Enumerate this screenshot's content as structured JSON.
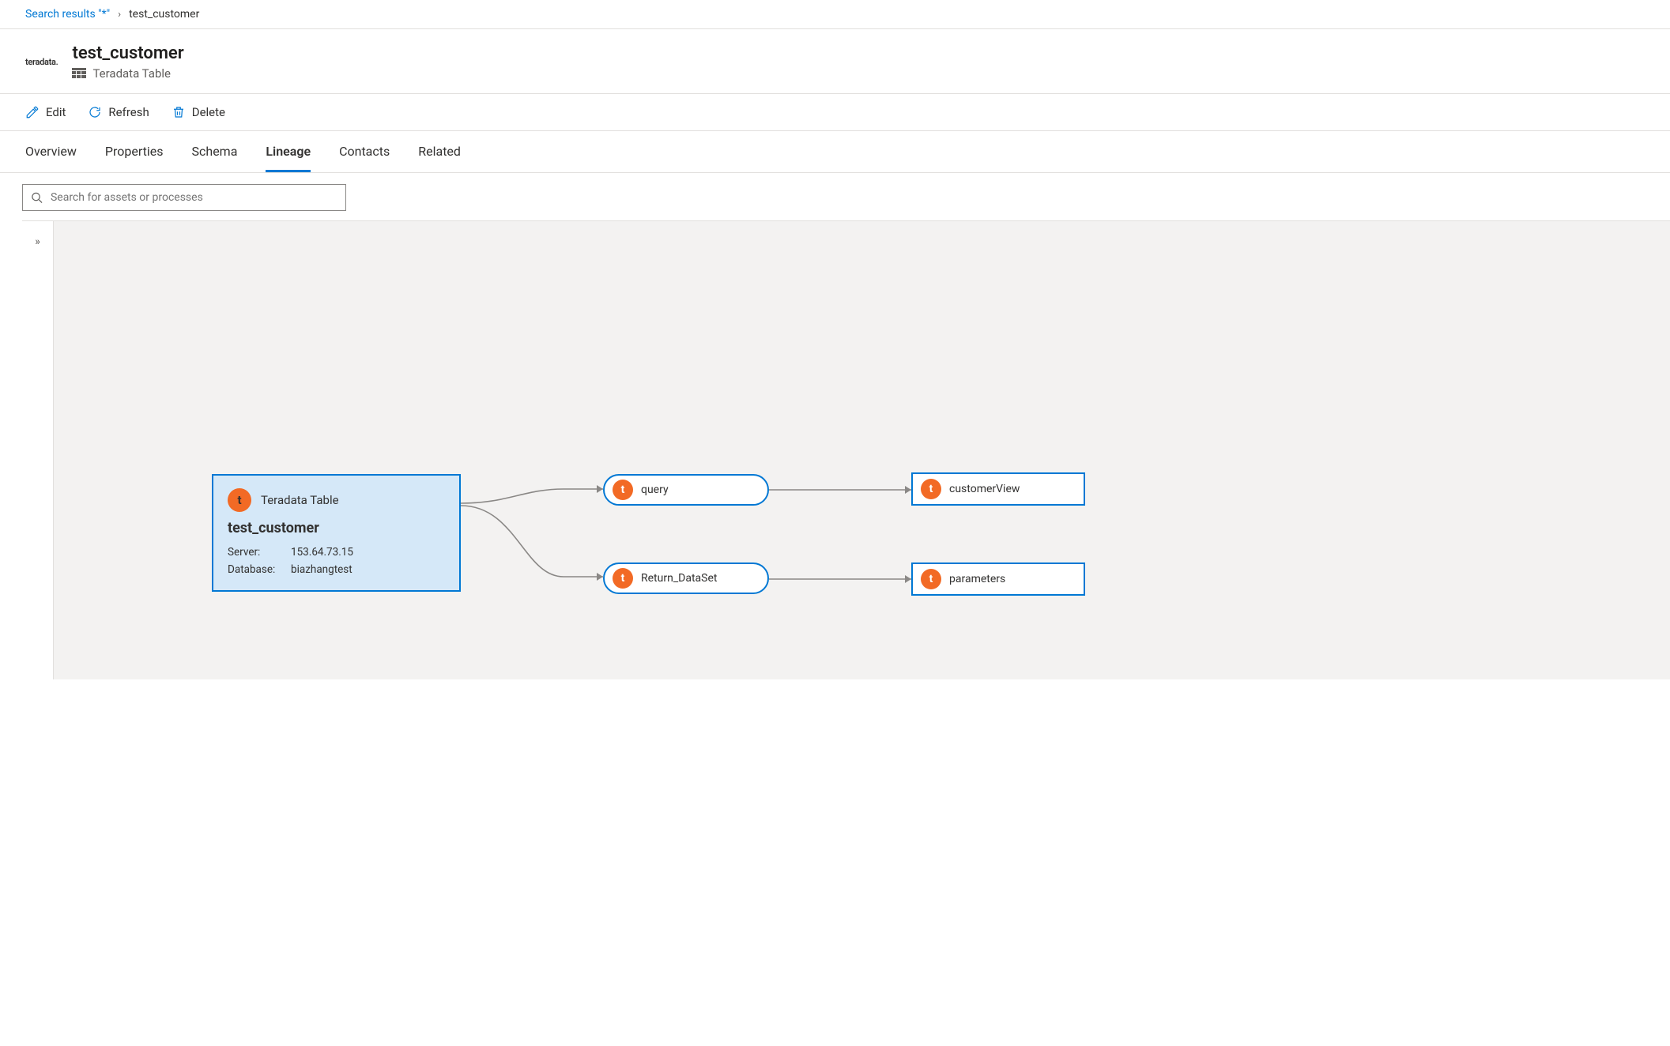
{
  "breadcrumb": {
    "search_label": "Search results ",
    "search_query": "\"*\"",
    "current": "test_customer"
  },
  "brandmark": "teradata.",
  "asset": {
    "name": "test_customer",
    "type": "Teradata Table"
  },
  "actions": {
    "edit": "Edit",
    "refresh": "Refresh",
    "delete": "Delete"
  },
  "tabs": {
    "overview": "Overview",
    "properties": "Properties",
    "schema": "Schema",
    "lineage": "Lineage",
    "contacts": "Contacts",
    "related": "Related",
    "active": "lineage"
  },
  "search": {
    "placeholder": "Search for assets or processes"
  },
  "lineage": {
    "main": {
      "type": "Teradata Table",
      "name": "test_customer",
      "server_label": "Server:",
      "server": "153.64.73.15",
      "database_label": "Database:",
      "database": "biazhangtest"
    },
    "nodes": {
      "query": "query",
      "return_dataset": "Return_DataSet",
      "customer_view": "customerView",
      "parameters": "parameters"
    }
  }
}
